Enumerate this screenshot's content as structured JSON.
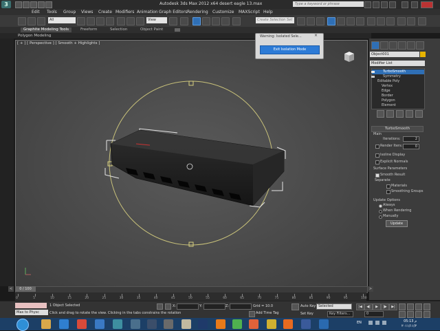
{
  "titlebar": {
    "app_logo": "3",
    "title": "Autodesk 3ds Max  2012 x64      desert eagle 13.max",
    "search_placeholder": "Type a keyword or phrase"
  },
  "menu": [
    "Edit",
    "Tools",
    "Group",
    "Views",
    "Create",
    "Modifiers",
    "Animation",
    "Graph Editors",
    "Rendering",
    "Customize",
    "MAXScript",
    "Help"
  ],
  "toolbar": {
    "selection_filter": "All",
    "ref_coord": "View",
    "named_sel_placeholder": "Create Selection Set"
  },
  "ribbon": {
    "tabs": [
      "Graphite Modeling Tools",
      "Freeform",
      "Selection",
      "Object Paint"
    ],
    "active_tab": "Graphite Modeling Tools",
    "sub_label": "Polygon Modeling"
  },
  "viewport": {
    "label": "[ + ] [ Perspective ] [ Smooth + Highlights ]"
  },
  "dialog": {
    "title": "Warning: Isolated Sele...",
    "close": "×",
    "button": "Exit Isolation Mode"
  },
  "command_panel": {
    "object_name": "Object001",
    "object_color": "#e8b400",
    "modifier_list": "Modifier List",
    "stack": [
      {
        "label": "TurboSmooth",
        "selected": true
      },
      {
        "label": "Symmetry",
        "selected": false
      },
      {
        "label": "Editable Poly",
        "selected": false
      },
      {
        "label": "Vertex",
        "selected": false
      },
      {
        "label": "Edge",
        "selected": false
      },
      {
        "label": "Border",
        "selected": false
      },
      {
        "label": "Polygon",
        "selected": false
      },
      {
        "label": "Element",
        "selected": false
      }
    ],
    "rollout_title": "TurboSmooth",
    "main_label": "Main",
    "iterations_label": "Iterations:",
    "iterations_value": "2",
    "render_iters_label": "Render Iters:",
    "render_iters_value": "0",
    "isoline_label": "Isoline Display",
    "explicit_label": "Explicit Normals",
    "surface_header": "Surface Parameters",
    "smooth_result_label": "Smooth Result",
    "separate_label": "Separate",
    "materials_label": "Materials",
    "smoothing_groups_label": "Smoothing Groups",
    "update_header": "Update Options",
    "always_label": "Always",
    "when_rendering_label": "When Rendering",
    "manually_label": "Manually",
    "update_button": "Update"
  },
  "timeline": {
    "slider_label": "0 / 100",
    "ticks": [
      "0",
      "5",
      "10",
      "15",
      "20",
      "25",
      "30",
      "35",
      "40",
      "45",
      "50",
      "55",
      "60",
      "65",
      "70",
      "75",
      "80",
      "85",
      "90",
      "95",
      "100"
    ]
  },
  "status": {
    "maxscript_label": "Max to Physc",
    "selected_count": "1 Object Selected",
    "prompt": "Click and drag to rotate the view.  Clicking in the tabs constrains the rotation",
    "x_label": "X:",
    "y_label": "Y:",
    "z_label": "Z:",
    "grid": "Grid = 10.0",
    "add_time_tag": "Add Time Tag",
    "auto_key": "Auto Key",
    "set_key": "Set Key",
    "selected_dd": "Selected",
    "key_filters": "Key Filters...",
    "frame": "0"
  },
  "taskbar": {
    "language": "EN",
    "time": "05:13 م",
    "date": "٢٠١١/١١/٢"
  }
}
